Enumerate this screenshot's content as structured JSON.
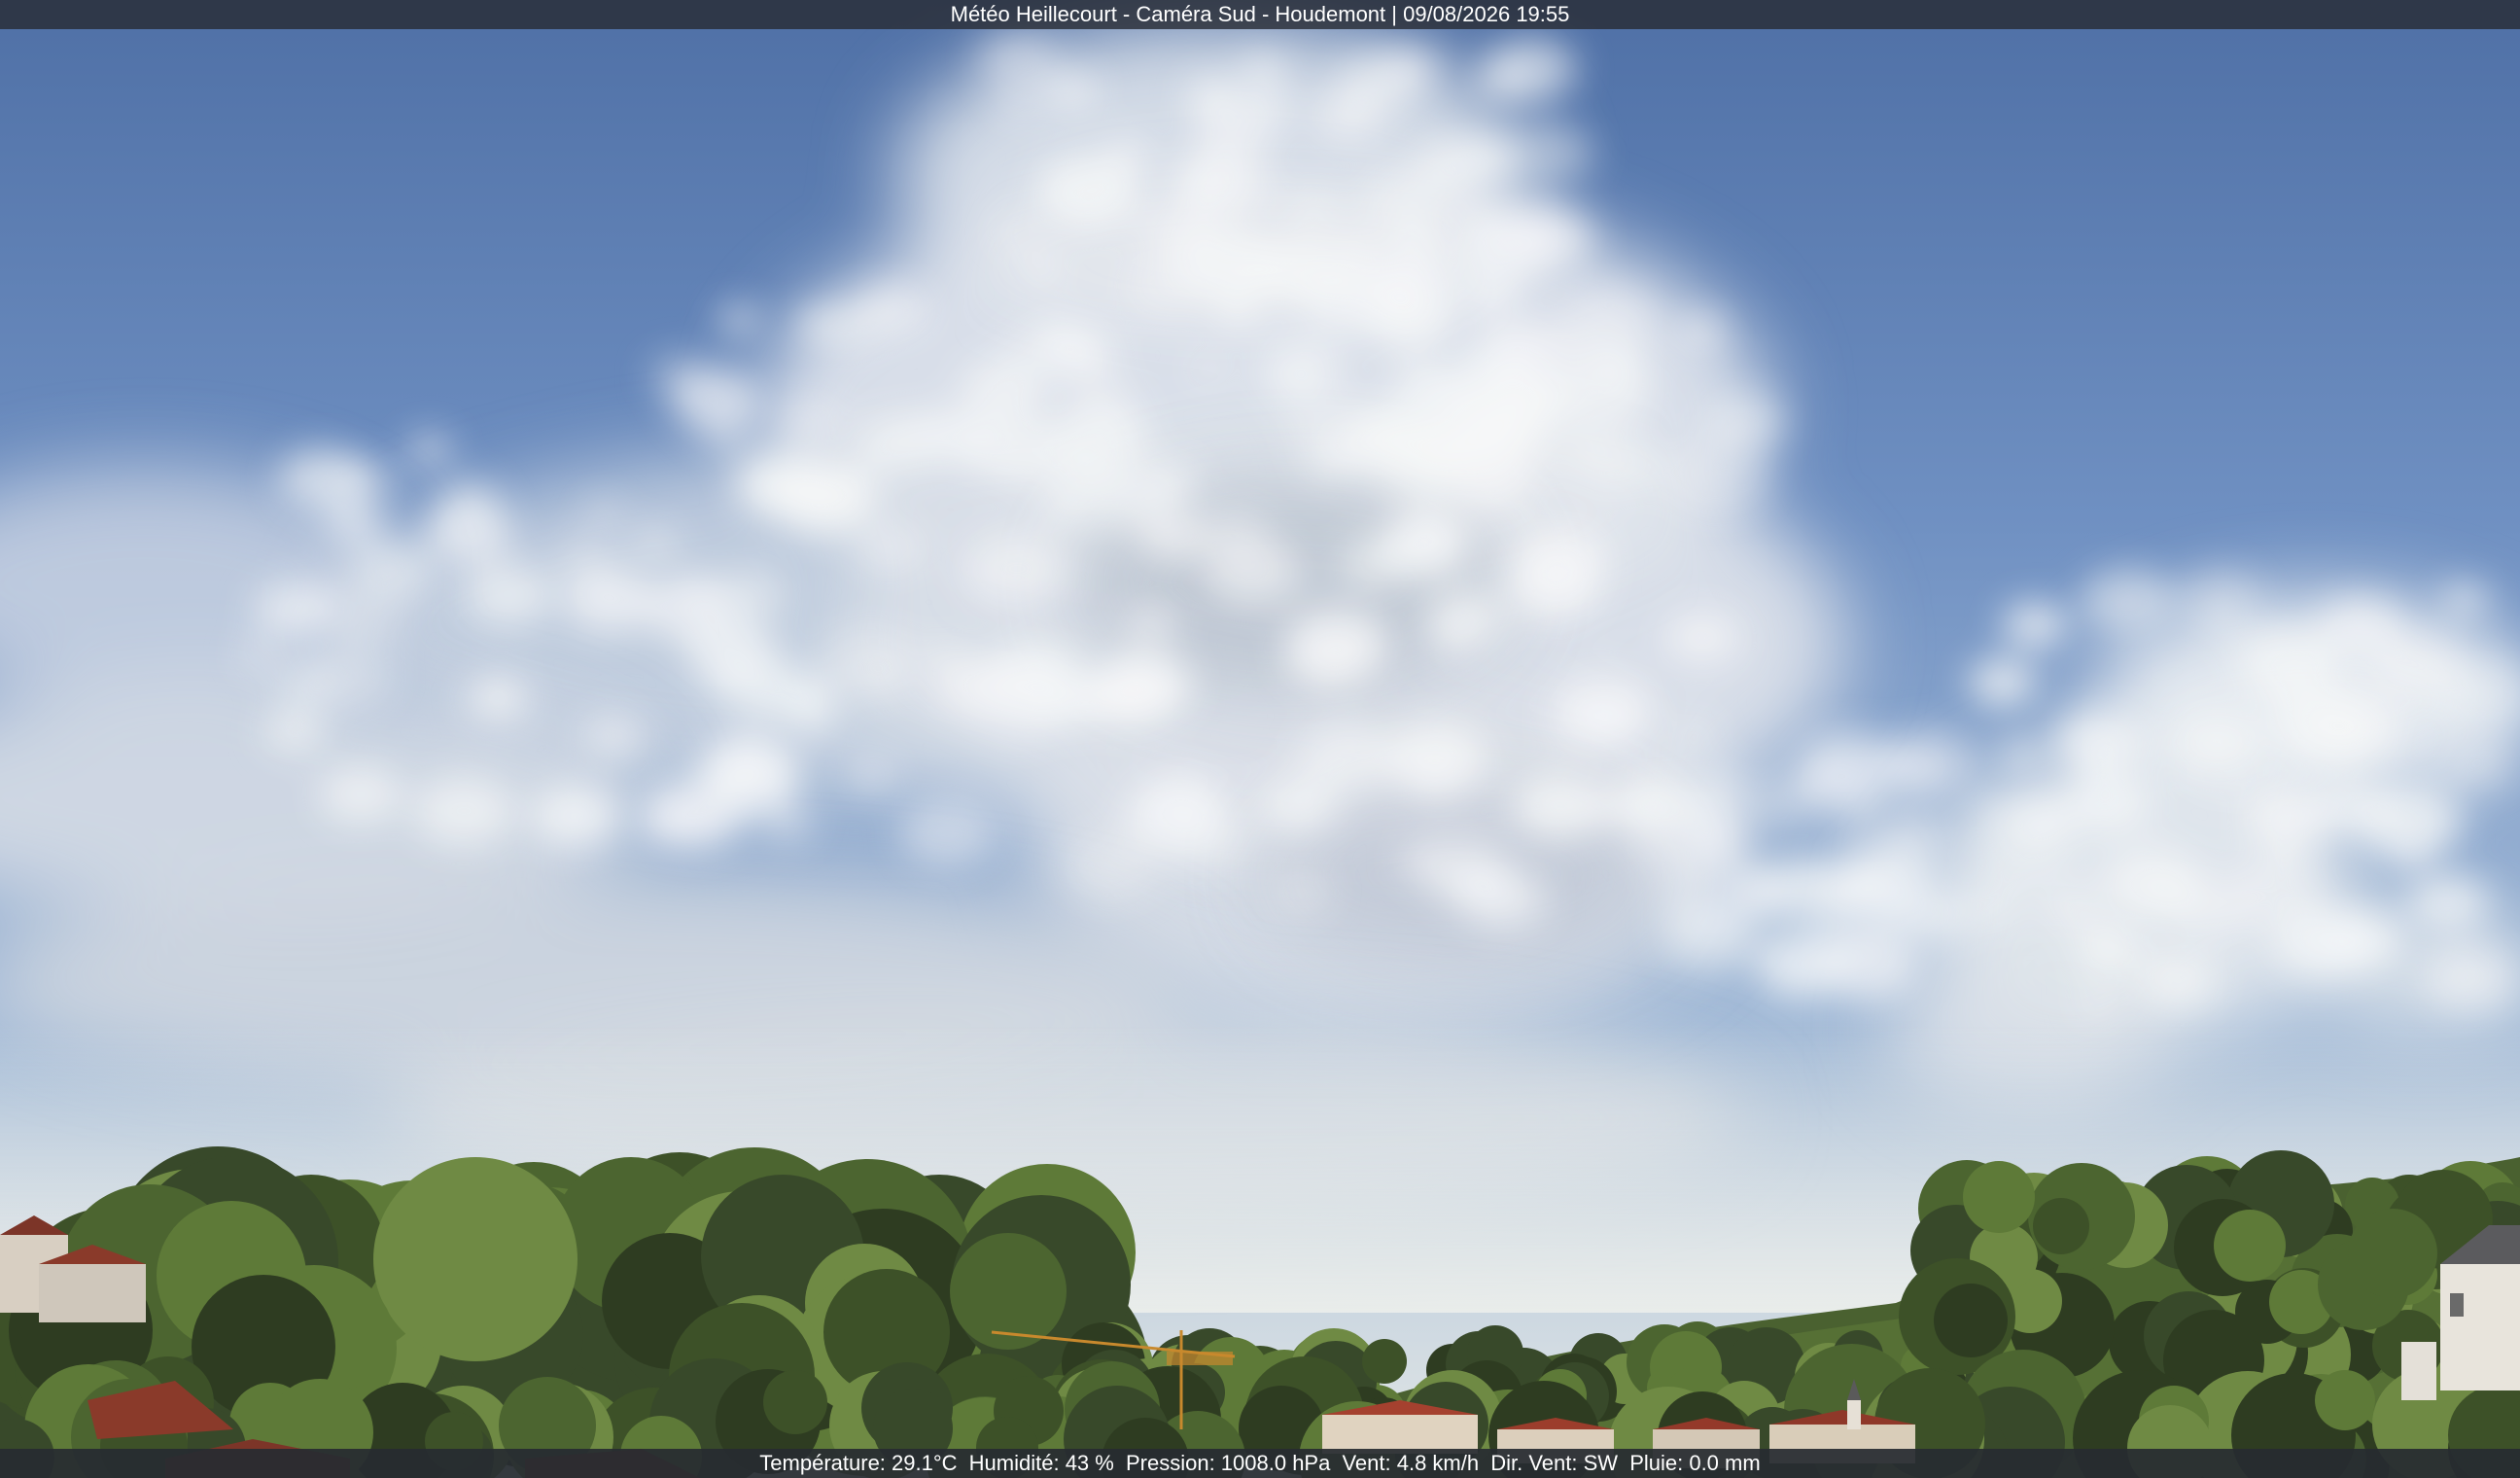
{
  "overlay": {
    "title": "Météo Heillecourt - Caméra Sud - Houdemont | 09/08/2026 19:55",
    "readings": [
      "Température: 29.1°C",
      "Humidité: 43 %",
      "Pression: 1008.0 hPa",
      "Vent: 4.8 km/h",
      "Dir. Vent: SW",
      "Pluie: 0.0 mm"
    ]
  },
  "colors": {
    "sky_top": "#5a7bb0",
    "sky_mid": "#89a6cf",
    "sky_horizon": "#dfe6ea",
    "cloud": "#eef0f2",
    "cloud_shadow": "#a9b4c4",
    "trees_dark": "#2f3d22",
    "trees_light": "#5c7a36",
    "roof": "#8a3a2a",
    "bar_bg": "#282c34",
    "bar_text": "#ffffff"
  },
  "scene": {
    "subject": "webcam-sky-panorama",
    "features": [
      "altocumulus-clouds",
      "tree-line",
      "hillside",
      "rooftops",
      "construction-crane"
    ]
  }
}
